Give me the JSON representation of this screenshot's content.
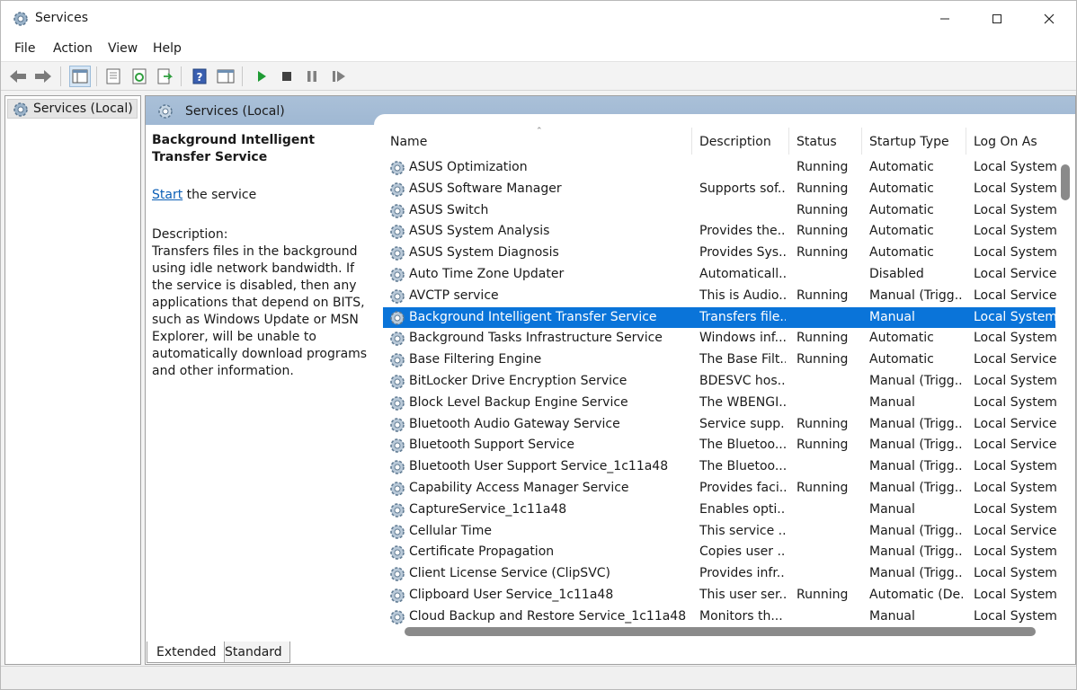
{
  "window": {
    "title": "Services",
    "controls": {
      "minimize": "minimize",
      "maximize": "maximize",
      "close": "close"
    }
  },
  "menu": [
    "File",
    "Action",
    "View",
    "Help"
  ],
  "toolbar": {
    "icons": [
      "back-arrow-icon",
      "forward-arrow-icon",
      "show-hide-console-tree-icon",
      "properties-icon",
      "refresh-icon",
      "export-list-icon",
      "help-icon",
      "action-pane-icon",
      "start-service-icon",
      "stop-service-icon",
      "pause-service-icon",
      "restart-service-icon"
    ]
  },
  "tree": {
    "root_label": "Services (Local)"
  },
  "main_header": {
    "title": "Services (Local)"
  },
  "description_panel": {
    "service_name": "Background Intelligent Transfer Service",
    "action_link": "Start",
    "action_suffix": " the service",
    "description_label": "Description:",
    "description_text": "Transfers files in the background using idle network bandwidth. If the service is disabled, then any applications that depend on BITS, such as Windows Update or MSN Explorer, will be unable to automatically download programs and other information."
  },
  "columns": {
    "name": "Name",
    "description": "Description",
    "status": "Status",
    "startup_type": "Startup Type",
    "log_on_as": "Log On As"
  },
  "services": [
    {
      "name": "ASUS Optimization",
      "description": "",
      "status": "Running",
      "startup": "Automatic",
      "logon": "Local System"
    },
    {
      "name": "ASUS Software Manager",
      "description": "Supports sof...",
      "status": "Running",
      "startup": "Automatic",
      "logon": "Local System"
    },
    {
      "name": "ASUS Switch",
      "description": "",
      "status": "Running",
      "startup": "Automatic",
      "logon": "Local System"
    },
    {
      "name": "ASUS System Analysis",
      "description": "Provides the...",
      "status": "Running",
      "startup": "Automatic",
      "logon": "Local System"
    },
    {
      "name": "ASUS System Diagnosis",
      "description": "Provides Sys...",
      "status": "Running",
      "startup": "Automatic",
      "logon": "Local System"
    },
    {
      "name": "Auto Time Zone Updater",
      "description": "Automaticall...",
      "status": "",
      "startup": "Disabled",
      "logon": "Local Service"
    },
    {
      "name": "AVCTP service",
      "description": "This is Audio...",
      "status": "Running",
      "startup": "Manual (Trigg...",
      "logon": "Local Service"
    },
    {
      "name": "Background Intelligent Transfer Service",
      "description": "Transfers file...",
      "status": "",
      "startup": "Manual",
      "logon": "Local System",
      "selected": true
    },
    {
      "name": "Background Tasks Infrastructure Service",
      "description": "Windows inf...",
      "status": "Running",
      "startup": "Automatic",
      "logon": "Local System"
    },
    {
      "name": "Base Filtering Engine",
      "description": "The Base Filt...",
      "status": "Running",
      "startup": "Automatic",
      "logon": "Local Service"
    },
    {
      "name": "BitLocker Drive Encryption Service",
      "description": "BDESVC hos...",
      "status": "",
      "startup": "Manual (Trigg...",
      "logon": "Local System"
    },
    {
      "name": "Block Level Backup Engine Service",
      "description": "The WBENGI...",
      "status": "",
      "startup": "Manual",
      "logon": "Local System"
    },
    {
      "name": "Bluetooth Audio Gateway Service",
      "description": "Service supp...",
      "status": "Running",
      "startup": "Manual (Trigg...",
      "logon": "Local Service"
    },
    {
      "name": "Bluetooth Support Service",
      "description": "The Bluetoo...",
      "status": "Running",
      "startup": "Manual (Trigg...",
      "logon": "Local Service"
    },
    {
      "name": "Bluetooth User Support Service_1c11a48",
      "description": "The Bluetoo...",
      "status": "",
      "startup": "Manual (Trigg...",
      "logon": "Local System"
    },
    {
      "name": "Capability Access Manager Service",
      "description": "Provides faci...",
      "status": "Running",
      "startup": "Manual (Trigg...",
      "logon": "Local System"
    },
    {
      "name": "CaptureService_1c11a48",
      "description": "Enables opti...",
      "status": "",
      "startup": "Manual",
      "logon": "Local System"
    },
    {
      "name": "Cellular Time",
      "description": "This service ...",
      "status": "",
      "startup": "Manual (Trigg...",
      "logon": "Local Service"
    },
    {
      "name": "Certificate Propagation",
      "description": "Copies user ...",
      "status": "",
      "startup": "Manual (Trigg...",
      "logon": "Local System"
    },
    {
      "name": "Client License Service (ClipSVC)",
      "description": "Provides infr...",
      "status": "",
      "startup": "Manual (Trigg...",
      "logon": "Local System"
    },
    {
      "name": "Clipboard User Service_1c11a48",
      "description": "This user ser...",
      "status": "Running",
      "startup": "Automatic (De...",
      "logon": "Local System"
    },
    {
      "name": "Cloud Backup and Restore Service_1c11a48",
      "description": "Monitors th...",
      "status": "",
      "startup": "Manual",
      "logon": "Local System"
    }
  ],
  "tabs": [
    "Extended",
    "Standard"
  ],
  "colors": {
    "selection": "#0a74d9",
    "header_band": "#a6bdd6",
    "link": "#0b5fb6"
  }
}
